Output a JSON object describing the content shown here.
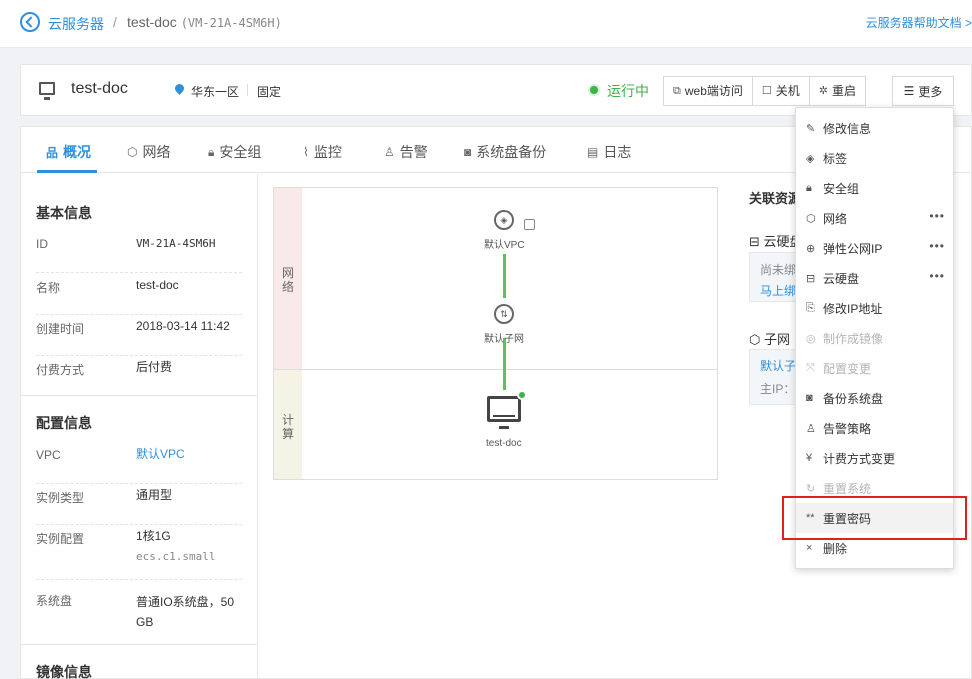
{
  "breadcrumb": {
    "parent": "云服务器",
    "separator": "/",
    "current_name": "test-doc",
    "current_id": "(VM-21A-4SM6H)"
  },
  "help_link": "云服务器帮助文档 >",
  "header": {
    "instance_name": "test-doc",
    "region": "华东一区",
    "ip_type": "固定",
    "status": "运行中",
    "buttons": [
      {
        "icon": "web-console-icon",
        "glyph": "⧉",
        "label": "web端访问"
      },
      {
        "icon": "power-off-icon",
        "glyph": "☐",
        "label": "关机"
      },
      {
        "icon": "restart-icon",
        "glyph": "✲",
        "label": "重启"
      }
    ],
    "more_label": "更多"
  },
  "tabs": [
    {
      "id": "overview",
      "glyph": "品",
      "label": "概况",
      "active": true
    },
    {
      "id": "network",
      "glyph": "⬡",
      "label": "网络",
      "active": false
    },
    {
      "id": "security-group",
      "glyph": "🔒︎",
      "label": "安全组",
      "active": false
    },
    {
      "id": "monitor",
      "glyph": "⌇",
      "label": "监控",
      "active": false
    },
    {
      "id": "alarm",
      "glyph": "♙",
      "label": "告警",
      "active": false
    },
    {
      "id": "system-disk-backup",
      "glyph": "◙",
      "label": "系统盘备份",
      "active": false
    },
    {
      "id": "log",
      "glyph": "▤",
      "label": "日志",
      "active": false
    }
  ],
  "basic_info": {
    "title": "基本信息",
    "rows": [
      {
        "label": "ID",
        "value": "VM-21A-4SM6H"
      },
      {
        "label": "名称",
        "value": "test-doc"
      },
      {
        "label": "创建时间",
        "value": "2018-03-14 11:42"
      },
      {
        "label": "付费方式",
        "value": "后付费"
      }
    ]
  },
  "config_info": {
    "title": "配置信息",
    "rows": [
      {
        "label": "VPC",
        "value": "默认VPC"
      },
      {
        "label": "实例类型",
        "value": "通用型"
      },
      {
        "label": "实例配置",
        "value": "1核1G",
        "sub": "ecs.c1.small"
      },
      {
        "label": "系统盘",
        "value": "普通IO系统盘，50 GB"
      }
    ]
  },
  "image_info": {
    "title": "镜像信息"
  },
  "topology": {
    "zone_network": "网络",
    "zone_compute": "计算",
    "vpc_label": "默认VPC",
    "subnet_label": "默认子网",
    "instance_label": "test-doc"
  },
  "related": {
    "title": "关联资源",
    "disk_title": "云硬盘",
    "disk_empty": "尚未绑定",
    "disk_link": "马上绑定",
    "subnet_title": "子网",
    "subnet_link": "默认子网",
    "subnet_ip": "主IP："
  },
  "more_menu": [
    {
      "glyph": "✎",
      "label": "修改信息",
      "disabled": false,
      "submenu": false
    },
    {
      "glyph": "◈",
      "label": "标签",
      "disabled": false,
      "submenu": false
    },
    {
      "glyph": "🔒︎",
      "label": "安全组",
      "disabled": false,
      "submenu": false
    },
    {
      "glyph": "⬡",
      "label": "网络",
      "disabled": false,
      "submenu": true
    },
    {
      "glyph": "⊕",
      "label": "弹性公网IP",
      "disabled": false,
      "submenu": true
    },
    {
      "glyph": "⊟",
      "label": "云硬盘",
      "disabled": false,
      "submenu": true
    },
    {
      "glyph": "⎘",
      "label": "修改IP地址",
      "disabled": false,
      "submenu": false
    },
    {
      "glyph": "◎",
      "label": "制作成镜像",
      "disabled": true,
      "submenu": false
    },
    {
      "glyph": "⤧",
      "label": "配置变更",
      "disabled": true,
      "submenu": false
    },
    {
      "glyph": "◙",
      "label": "备份系统盘",
      "disabled": false,
      "submenu": false
    },
    {
      "glyph": "♙",
      "label": "告警策略",
      "disabled": false,
      "submenu": false
    },
    {
      "glyph": "¥",
      "label": "计费方式变更",
      "disabled": false,
      "submenu": false
    },
    {
      "glyph": "↻",
      "label": "重置系统",
      "disabled": true,
      "submenu": false
    },
    {
      "glyph": "**",
      "label": "重置密码",
      "disabled": false,
      "submenu": false,
      "hover": true
    },
    {
      "glyph": "×",
      "label": "删除",
      "disabled": false,
      "submenu": false
    }
  ],
  "submenu_glyph": "•••",
  "colors": {
    "accent": "#2f8fdd",
    "running": "#3cb24a",
    "highlight": "#e02020"
  }
}
